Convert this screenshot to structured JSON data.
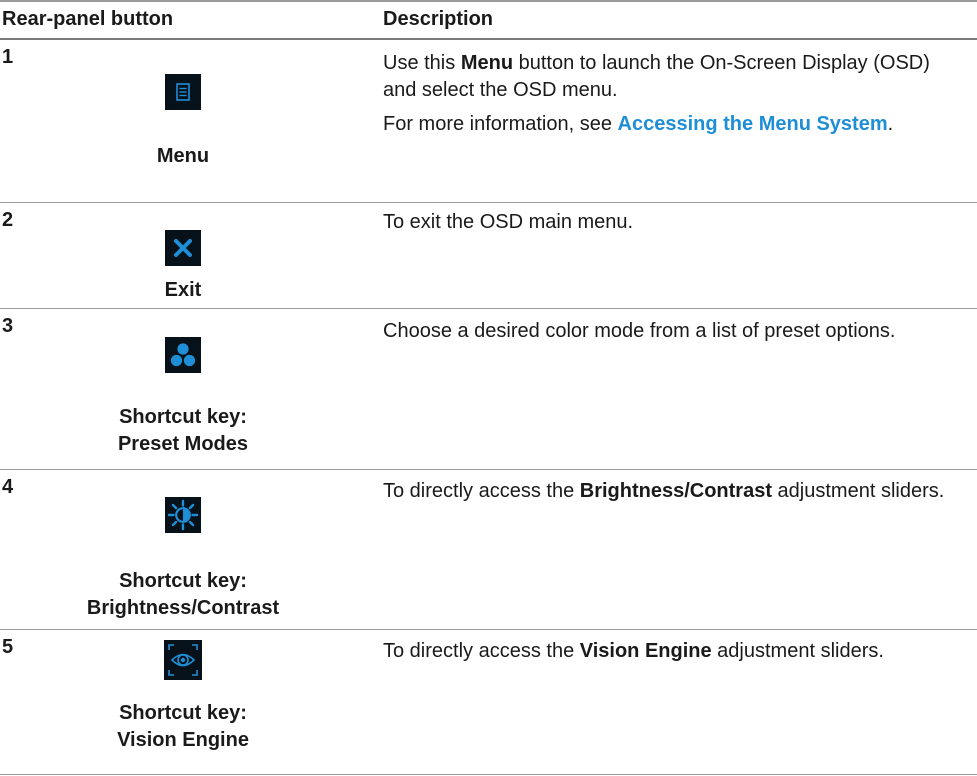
{
  "header": {
    "col1": "Rear-panel button",
    "col2": "Description"
  },
  "rows": [
    {
      "num": "1",
      "icon": "menu-icon",
      "caption": "Menu",
      "desc_pre": "Use this ",
      "desc_bold": "Menu",
      "desc_post": " button to launch the On-Screen Display (OSD) and select the OSD menu.",
      "para2_pre": "For more information, see ",
      "para2_link": "Accessing the Menu System",
      "para2_post": "."
    },
    {
      "num": "2",
      "icon": "exit-icon",
      "caption": "Exit",
      "desc": "To exit the OSD main menu."
    },
    {
      "num": "3",
      "icon": "preset-modes-icon",
      "caption_line1": "Shortcut key:",
      "caption_line2": "Preset Modes",
      "desc": "Choose a desired color mode from a list of preset options."
    },
    {
      "num": "4",
      "icon": "brightness-contrast-icon",
      "caption_line1": "Shortcut key:",
      "caption_line2": "Brightness/Contrast",
      "desc_pre": "To directly access the ",
      "desc_bold": "Brightness/Contrast",
      "desc_post": " adjustment sliders."
    },
    {
      "num": "5",
      "icon": "vision-engine-icon",
      "caption_line1": "Shortcut key:",
      "caption_line2": "Vision Engine",
      "desc_pre": "To directly access the ",
      "desc_bold": "Vision Engine",
      "desc_post": " adjustment sliders."
    }
  ],
  "colors": {
    "link": "#1e8fd6",
    "icon_bg": "#07111a",
    "icon_accent": "#1e8fd6"
  }
}
